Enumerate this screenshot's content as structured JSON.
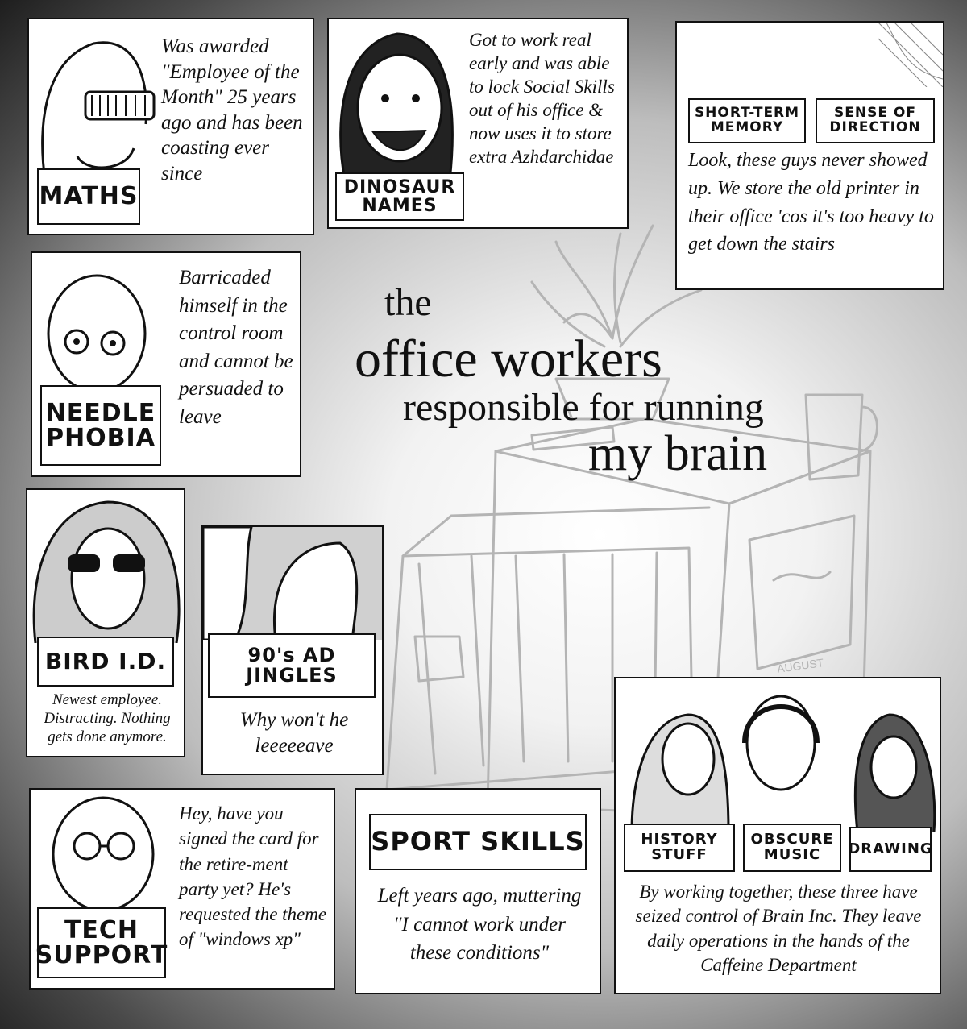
{
  "title": {
    "line1": "the",
    "line2": "office workers",
    "line3": "responsible for running",
    "line4": "my brain"
  },
  "panels": {
    "maths": {
      "label": "MATHS",
      "caption": "Was awarded \"Employee of the Month\" 25 years ago and has been coasting ever since"
    },
    "dinosaur": {
      "label": "DINOSAUR NAMES",
      "caption": "Got to work real early and was able to lock Social Skills out of his office & now uses it to store extra Azhdarchidae"
    },
    "shortterm": {
      "label1": "SHORT-TERM MEMORY",
      "label2": "SENSE OF DIRECTION",
      "caption": "Look, these guys never showed up. We store the old printer in their office 'cos it's too heavy to get down the stairs"
    },
    "needle": {
      "label": "NEEDLE PHOBIA",
      "caption": "Barricaded himself in the control room and cannot be persuaded to leave"
    },
    "bird": {
      "label": "BIRD I.D.",
      "caption": "Newest employee. Distracting. Nothing gets done anymore."
    },
    "jingles": {
      "label": "90's AD JINGLES",
      "caption": "Why won't he leeeeeave"
    },
    "tech": {
      "label": "TECH SUPPORT",
      "caption": "Hey, have you signed the card for the retire-ment party yet? He's requested the theme of \"windows xp\""
    },
    "sport": {
      "label": "SPORT SKILLS",
      "caption": "Left years ago, muttering \"I cannot work under these conditions\""
    },
    "trio": {
      "label1": "HISTORY STUFF",
      "label2": "OBSCURE MUSIC",
      "label3": "DRAWING",
      "caption": "By working together, these three have seized control of Brain Inc. They leave daily operations in the hands of the Caffeine Department"
    }
  },
  "sketch_text": "AUGUST",
  "colors": {
    "ink": "#111111",
    "paper": "#ffffff",
    "sketch": "#b4b4b4"
  }
}
